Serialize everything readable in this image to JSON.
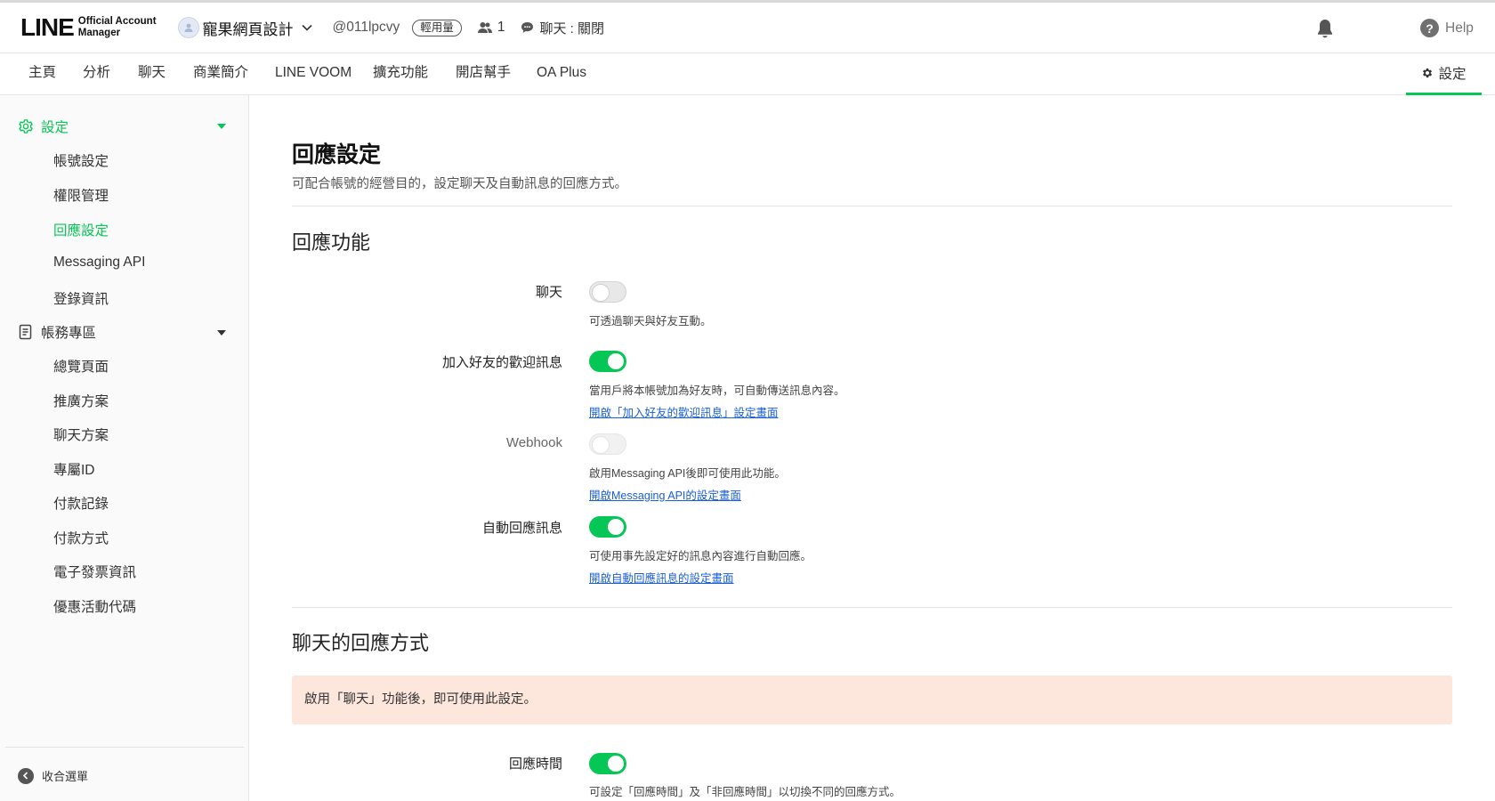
{
  "header": {
    "logo_main": "LINE",
    "logo_sub_1": "Official Account",
    "logo_sub_2": "Manager",
    "account_name": "寵果網頁設計",
    "account_id": "@011lpcvy",
    "plan_badge": "輕用量",
    "friends_count": "1",
    "chat_status": "聊天 : 關閉",
    "help_label": "Help"
  },
  "nav": {
    "items": [
      "主頁",
      "分析",
      "聊天",
      "商業簡介",
      "LINE VOOM",
      "擴充功能",
      "開店幫手",
      "OA Plus"
    ],
    "settings_label": "設定"
  },
  "sidebar": {
    "group1_label": "設定",
    "group1_items": [
      "帳號設定",
      "權限管理",
      "回應設定",
      "Messaging API",
      "登錄資訊"
    ],
    "active_item": "回應設定",
    "group2_label": "帳務專區",
    "group2_items": [
      "總覽頁面",
      "推廣方案",
      "聊天方案",
      "專屬ID",
      "付款記錄",
      "付款方式",
      "電子發票資訊",
      "優惠活動代碼"
    ],
    "collapse_label": "收合選單"
  },
  "main": {
    "title": "回應設定",
    "subtitle": "可配合帳號的經營目的，設定聊天及自動訊息的回應方式。",
    "section1_title": "回應功能",
    "rows": [
      {
        "label": "聊天",
        "state": "off",
        "desc": "可透過聊天與好友互動。",
        "link": ""
      },
      {
        "label": "加入好友的歡迎訊息",
        "state": "on",
        "desc": "當用戶將本帳號加為好友時，可自動傳送訊息內容。",
        "link": "開啟「加入好友的歡迎訊息」設定畫面"
      },
      {
        "label": "Webhook",
        "state": "disabled",
        "desc": "啟用Messaging API後即可使用此功能。",
        "link": "開啟Messaging API的設定畫面"
      },
      {
        "label": "自動回應訊息",
        "state": "on",
        "desc": "可使用事先設定好的訊息內容進行自動回應。",
        "link": "開啟自動回應訊息的設定畫面"
      }
    ],
    "section2_title": "聊天的回應方式",
    "notice": "啟用「聊天」功能後，即可使用此設定。",
    "response_time_label": "回應時間",
    "response_time_state": "on",
    "response_time_desc": "可設定「回應時間」及「非回應時間」以切換不同的回應方式。"
  },
  "colors": {
    "accent": "#06c755",
    "link": "#1a5fd6",
    "notice_bg": "#fde6dc"
  }
}
